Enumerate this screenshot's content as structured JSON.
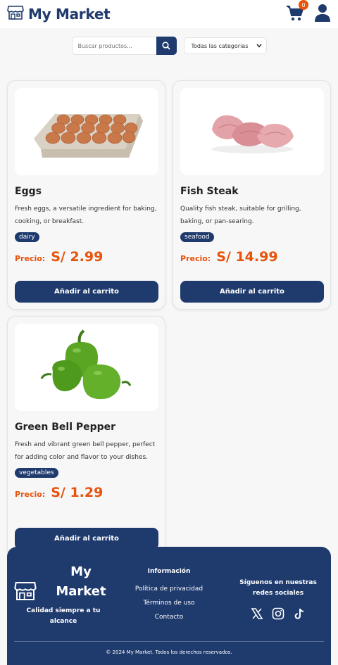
{
  "header": {
    "brand": "My Market",
    "cart_count": "0"
  },
  "search": {
    "placeholder": "Buscar productos...",
    "category_selected": "Todas las categorias"
  },
  "products": [
    {
      "name": "Eggs",
      "description": "Fresh eggs, a versatile ingredient for baking, cooking, or breakfast.",
      "tag": "dairy",
      "price_label": "Precio:",
      "price": "S/ 2.99",
      "button": "Añadir al carrito"
    },
    {
      "name": "Fish Steak",
      "description": "Quality fish steak, suitable for grilling, baking, or pan-searing.",
      "tag": "seafood",
      "price_label": "Precio:",
      "price": "S/ 14.99",
      "button": "Añadir al carrito"
    },
    {
      "name": "Green Bell Pepper",
      "description": "Fresh and vibrant green bell pepper, perfect for adding color and flavor to your dishes.",
      "tag": "vegetables",
      "price_label": "Precio:",
      "price": "S/ 1.29",
      "button": "Añadir al carrito"
    }
  ],
  "footer": {
    "brand": "My Market",
    "tagline": "Calidad siempre a tu alcance",
    "info_title": "Información",
    "links": [
      "Política de privacidad",
      "Términos de uso",
      "Contacto"
    ],
    "social_title": "Síguenos en nuestras redes sociales",
    "copyright": "© 2024 My Market. Todos los derechos reservados."
  },
  "colors": {
    "primary": "#1f3a6d",
    "accent": "#e8520b",
    "background": "#f7f7f8"
  },
  "icons": [
    "store-icon",
    "cart-icon",
    "user-icon",
    "search-icon",
    "chevron-down-icon",
    "x-icon",
    "instagram-icon",
    "tiktok-icon"
  ]
}
